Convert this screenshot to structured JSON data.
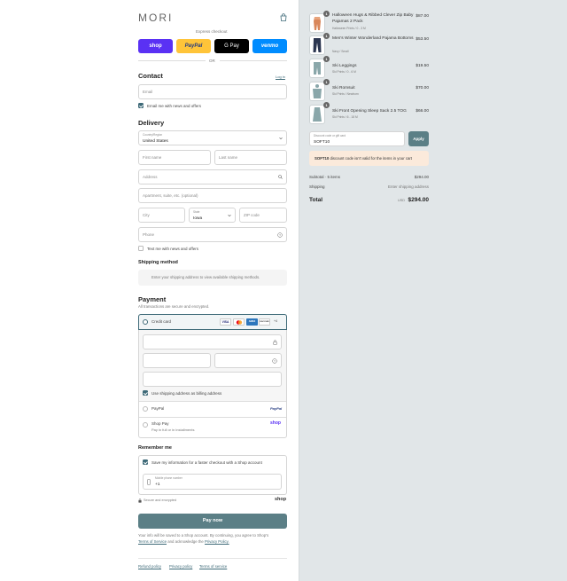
{
  "brand": {
    "logo": "MORI"
  },
  "express": {
    "label": "Express checkout",
    "buttons": [
      "shop",
      "PayPal",
      "G Pay",
      "venmo"
    ],
    "or": "OR"
  },
  "contact": {
    "title": "Contact",
    "login": "Log in",
    "email_placeholder": "Email",
    "news_label": "Email me with news and offers"
  },
  "delivery": {
    "title": "Delivery",
    "country_label": "Country/Region",
    "country_value": "United States",
    "first_name": "First name",
    "last_name": "Last name",
    "address": "Address",
    "apartment": "Apartment, suite, etc. (optional)",
    "city": "City",
    "state_label": "State",
    "state_value": "Iowa",
    "zip": "ZIP code",
    "phone": "Phone",
    "text_label": "Text me with news and offers"
  },
  "shipping": {
    "title": "Shipping method",
    "message": "Enter your shipping address to view available shipping methods."
  },
  "payment": {
    "title": "Payment",
    "subtitle": "All transactions are secure and encrypted.",
    "credit_card": "Credit card",
    "card_brands": [
      "VISA",
      "MC",
      "AMEX",
      "DISCOVER",
      "+4"
    ],
    "billing_label": "Use shipping address as billing address",
    "paypal": "PayPal",
    "paypal_logo": "PayPal",
    "shoppay": "Shop Pay",
    "shoppay_sub": "Pay in full or in installments",
    "shoppay_logo": "shop"
  },
  "remember": {
    "title": "Remember me",
    "save_label": "Save my information for a faster checkout with a Shop account",
    "phone_label": "Mobile phone number",
    "phone_value": "+1",
    "secure": "Secure and encrypted",
    "shop_logo": "shop"
  },
  "pay_button": "Pay now",
  "legal": {
    "line1": "Your info will be saved to a Shop account. By continuing, you agree to Shop's",
    "terms": "Terms of Service",
    "and": "and acknowledge the",
    "privacy": "Privacy Policy."
  },
  "footer": {
    "links": [
      "Refund policy",
      "Privacy policy",
      "Terms of service"
    ]
  },
  "cart": {
    "items": [
      {
        "qty": "1",
        "name": "Halloween Hugs & Ribbed Clever Zip Baby Pajamas 2 Pack",
        "variant": "Halloween Prints / 0 - 3 M",
        "price": "$87.00"
      },
      {
        "qty": "1",
        "name": "Men's Winter Wonderland Pajama Bottoms",
        "variant": "Navy / Small",
        "price": "$53.50"
      },
      {
        "qty": "1",
        "name": "Ski Leggings",
        "variant": "Ski Prints / 0 - 6 M",
        "price": "$19.50"
      },
      {
        "qty": "1",
        "name": "Ski Romsuit",
        "variant": "Ski Prints / Newborn",
        "price": "$70.00"
      },
      {
        "qty": "1",
        "name": "Ski Front Opening Sleep Sack 2.5 TOG",
        "variant": "Ski Prints / 6 - 18 M",
        "price": "$66.00"
      }
    ],
    "discount_label": "Discount code or gift card",
    "discount_value": "SOFT10",
    "apply": "Apply",
    "discount_error_code": "SOFT10",
    "discount_error_text": "discount code isn't valid for the items in your cart",
    "subtotal_label": "Subtotal · 5 items",
    "subtotal_value": "$294.00",
    "shipping_label": "Shipping",
    "shipping_value": "Enter shipping address",
    "total_label": "Total",
    "currency": "USD",
    "total_value": "$294.00"
  },
  "colors": {
    "accent": "#3e6a78",
    "shop": "#5a31f4",
    "paypal": "#ffc439",
    "gpay": "#000000",
    "venmo": "#008cff",
    "pay_button": "#5b7f86",
    "error_bg": "#fbeadb"
  }
}
